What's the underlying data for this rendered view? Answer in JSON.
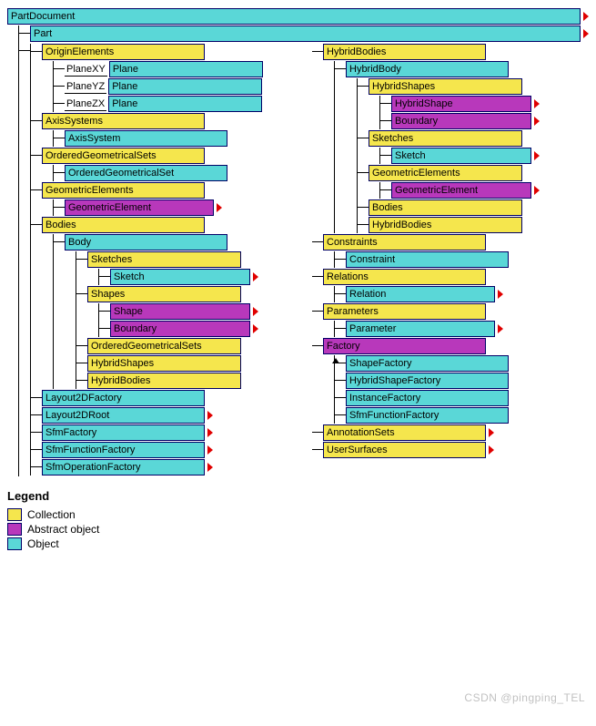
{
  "root": "PartDocument",
  "part": "Part",
  "left": {
    "originElements": "OriginElements",
    "planeXY_lbl": "PlaneXY",
    "planeXY": "Plane",
    "planeYZ_lbl": "PlaneYZ",
    "planeYZ": "Plane",
    "planeZX_lbl": "PlaneZX",
    "planeZX": "Plane",
    "axisSystems": "AxisSystems",
    "axisSystem": "AxisSystem",
    "ogs": "OrderedGeometricalSets",
    "ogsSet": "OrderedGeometricalSet",
    "geomElems": "GeometricElements",
    "geomElem": "GeometricElement",
    "bodies": "Bodies",
    "body": "Body",
    "sketches": "Sketches",
    "sketch": "Sketch",
    "shapes": "Shapes",
    "shape": "Shape",
    "boundary": "Boundary",
    "ogs2": "OrderedGeometricalSets",
    "hybridShapes": "HybridShapes",
    "hybridBodies": "HybridBodies",
    "layout2dFactory": "Layout2DFactory",
    "layout2dRoot": "Layout2DRoot",
    "sfmFactory": "SfmFactory",
    "sfmFunctionFactory": "SfmFunctionFactory",
    "sfmOperationFactory": "SfmOperationFactory"
  },
  "right": {
    "hybridBodies": "HybridBodies",
    "hybridBody": "HybridBody",
    "hybridShapes": "HybridShapes",
    "hybridShape": "HybridShape",
    "boundary": "Boundary",
    "sketches": "Sketches",
    "sketch": "Sketch",
    "geomElems": "GeometricElements",
    "geomElem": "GeometricElement",
    "bodies": "Bodies",
    "hybridBodies2": "HybridBodies",
    "constraints": "Constraints",
    "constraint": "Constraint",
    "relations": "Relations",
    "relation": "Relation",
    "parameters": "Parameters",
    "parameter": "Parameter",
    "factory": "Factory",
    "shapeFactory": "ShapeFactory",
    "hybridShapeFactory": "HybridShapeFactory",
    "instanceFactory": "InstanceFactory",
    "sfmFunctionFactory": "SfmFunctionFactory",
    "annotationSets": "AnnotationSets",
    "userSurfaces": "UserSurfaces"
  },
  "legend": {
    "title": "Legend",
    "collection": "Collection",
    "abstract": "Abstract object",
    "object": "Object"
  },
  "watermark": "CSDN @pingping_TEL"
}
